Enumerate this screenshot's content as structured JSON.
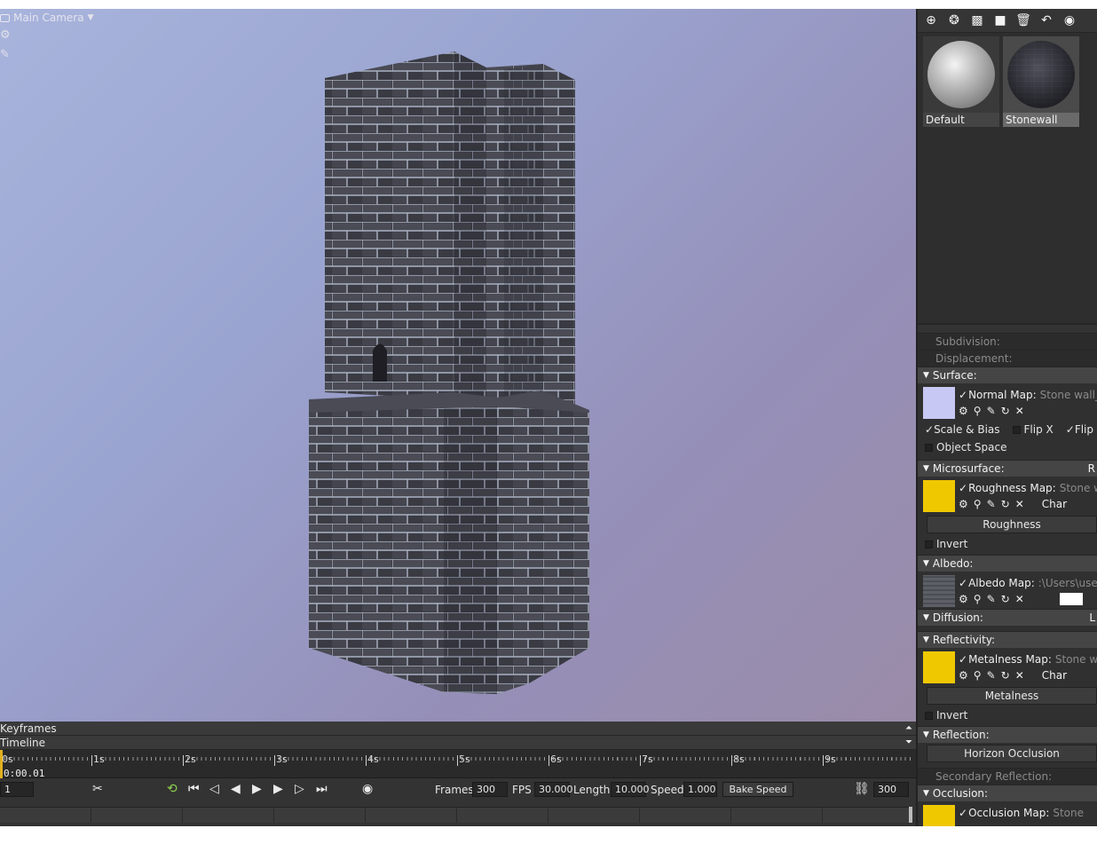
{
  "viewport": {
    "camera_label": "Main Camera",
    "colors": {
      "bg_top_left": "#a8b4dc",
      "bg_bottom_right": "#9a8ca8",
      "stone": "#3f4048",
      "mortar": "#c8d0e0"
    }
  },
  "materials": [
    {
      "name": "Default",
      "ball": "default"
    },
    {
      "name": "Stonewall",
      "ball": "stone"
    }
  ],
  "toolbar_icons": [
    "add-icon",
    "duplicate-icon",
    "checker-icon",
    "folder-icon",
    "trash-icon",
    "import-icon",
    "compass-icon"
  ],
  "properties": {
    "subdivision": "Subdivision:",
    "displacement": "Displacement:",
    "surface": {
      "title": "Surface:",
      "map_label": "Normal Map:",
      "map_value": "Stone wall_p",
      "swatch": "#c8c8f4",
      "scale_bias": "Scale & Bias",
      "flip_x": "Flip X",
      "flip_y": "Flip Y",
      "object_space": "Object Space"
    },
    "microsurface": {
      "title": "Microsurface:",
      "right": "R",
      "map_label": "Roughness Map:",
      "map_value": "Stone wa",
      "channel": "Char",
      "button": "Roughness",
      "invert": "Invert",
      "swatch": "#f0c800"
    },
    "albedo": {
      "title": "Albedo:",
      "map_label": "Albedo Map:",
      "map_value": ":\\Users\\user\\",
      "swatch": "#5c6066"
    },
    "diffusion": {
      "title": "Diffusion:",
      "right": "L"
    },
    "reflectivity": {
      "title": "Reflectivity:",
      "map_label": "Metalness Map:",
      "map_value": "Stone wall",
      "channel": "Char",
      "button": "Metalness",
      "invert": "Invert",
      "swatch": "#f0c800"
    },
    "reflection": {
      "title": "Reflection:",
      "button": "Horizon Occlusion"
    },
    "secondary_reflection": "Secondary Reflection:",
    "occlusion": {
      "title": "Occlusion:",
      "map_label": "Occlusion Map:",
      "map_value": "Stone",
      "swatch": "#f0c800"
    }
  },
  "timeline": {
    "keyframes_label": "Keyframes",
    "timeline_label": "Timeline",
    "ticks": [
      "0s",
      "1s",
      "2s",
      "3s",
      "4s",
      "5s",
      "6s",
      "7s",
      "8s",
      "9s"
    ],
    "current_time": "0:00.01",
    "frame_field": "1",
    "frames_label": "Frames",
    "frames_value": "300",
    "fps_label": "FPS",
    "fps_value": "30.000",
    "length_label": "Length",
    "length_value": "10.000",
    "speed_label": "Speed",
    "speed_value": "1.000",
    "bake_speed": "Bake Speed",
    "end_value": "300"
  }
}
